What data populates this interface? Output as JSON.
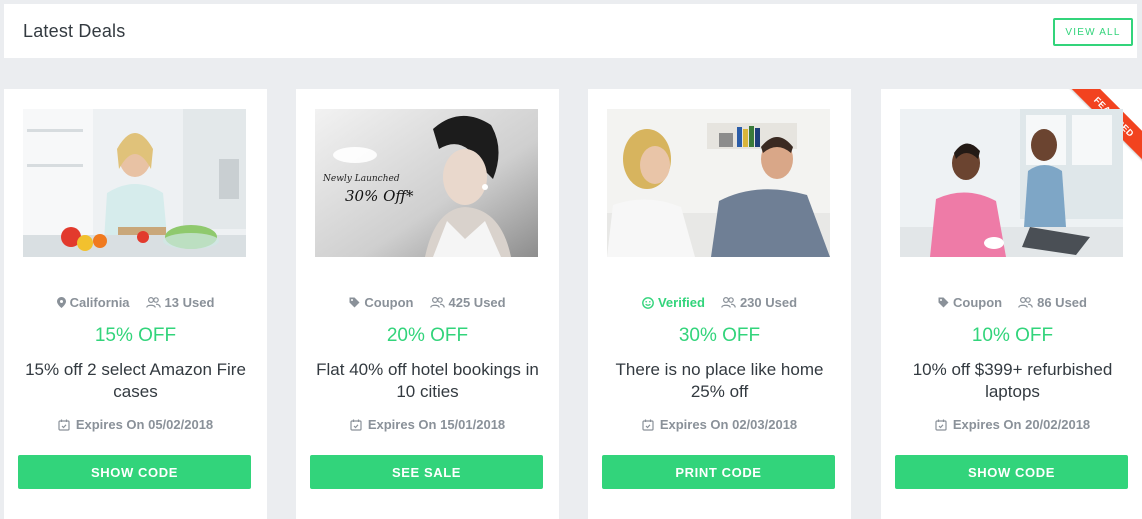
{
  "header": {
    "title": "Latest Deals",
    "view_all": "VIEW ALL"
  },
  "colors": {
    "accent": "#32d47b",
    "ribbon": "#f2431f",
    "muted": "#8a9199",
    "text": "#333a40"
  },
  "deals": [
    {
      "meta1": {
        "icon": "map-pin-icon",
        "text": "California"
      },
      "used": "13 Used",
      "discount": "15% OFF",
      "title": "15% off 2 select Amazon Fire cases",
      "expires": "Expires On 05/02/2018",
      "button": "SHOW CODE"
    },
    {
      "meta1": {
        "icon": "tag-icon",
        "text": "Coupon"
      },
      "used": "425 Used",
      "discount": "20% OFF",
      "title": "Flat 40% off hotel bookings in 10 cities",
      "expires": "Expires On 15/01/2018",
      "button": "SEE SALE",
      "image_text": {
        "line1": "Newly Launched",
        "line2": "30% Off*"
      }
    },
    {
      "meta1": {
        "icon": "smile-icon",
        "text": "Verified"
      },
      "used": "230 Used",
      "discount": "30% OFF",
      "title": "There is no place like home 25% off",
      "expires": "Expires On 02/03/2018",
      "button": "PRINT CODE"
    },
    {
      "meta1": {
        "icon": "tag-icon",
        "text": "Coupon"
      },
      "used": "86 Used",
      "discount": "10% OFF",
      "title": "10% off $399+ refurbished laptops",
      "expires": "Expires On 20/02/2018",
      "button": "SHOW CODE",
      "ribbon": "FEATURED"
    }
  ]
}
